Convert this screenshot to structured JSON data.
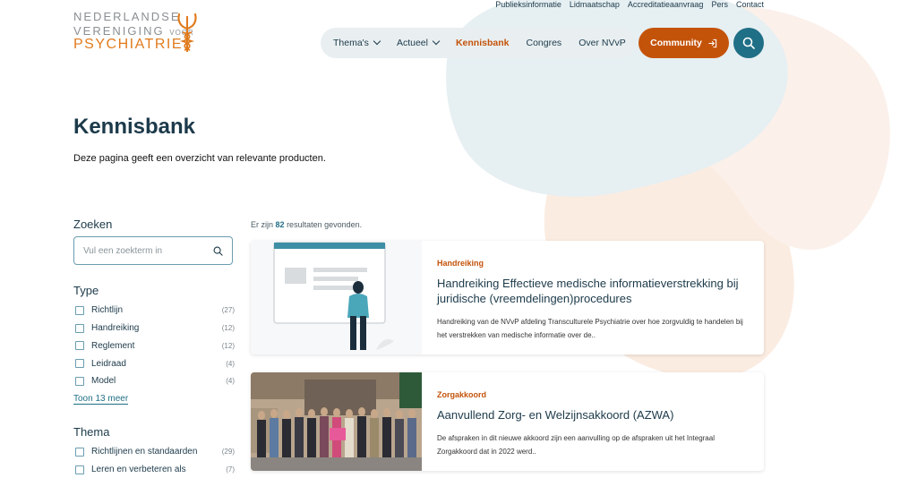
{
  "logo": {
    "line1": "NEDERLANDSE",
    "line2": "VERENIGING",
    "line2_small": "VOOR",
    "line3": "PSYCHIATRIE"
  },
  "top_links": [
    "Publieksinformatie",
    "Lidmaatschap",
    "Accreditatieaanvraag",
    "Pers",
    "Contact"
  ],
  "nav": {
    "items": [
      {
        "label": "Thema's",
        "dropdown": true
      },
      {
        "label": "Actueel",
        "dropdown": true
      },
      {
        "label": "Kennisbank",
        "dropdown": false,
        "active": true
      },
      {
        "label": "Congres",
        "dropdown": false
      },
      {
        "label": "Over NVvP",
        "dropdown": false
      }
    ],
    "community_label": "Community",
    "search_icon": "search-icon"
  },
  "page": {
    "title": "Kennisbank",
    "intro": "Deze pagina geeft een overzicht van relevante producten."
  },
  "sidebar": {
    "search_heading": "Zoeken",
    "search_placeholder": "Vul een zoekterm in",
    "type_heading": "Type",
    "type_items": [
      {
        "label": "Richtlijn",
        "count": "(27)"
      },
      {
        "label": "Handreiking",
        "count": "(12)"
      },
      {
        "label": "Reglement",
        "count": "(12)"
      },
      {
        "label": "Leidraad",
        "count": "(4)"
      },
      {
        "label": "Model",
        "count": "(4)"
      }
    ],
    "show_more": "Toon 13 meer",
    "thema_heading": "Thema",
    "thema_items": [
      {
        "label": "Richtlijnen en standaarden",
        "count": "(29)"
      },
      {
        "label": "Leren en verbeteren als",
        "count": "(7)"
      }
    ]
  },
  "results": {
    "count_prefix": "Er zijn",
    "count": "82",
    "count_suffix": "resultaten gevonden.",
    "items": [
      {
        "tag": "Handreiking",
        "title": "Handreiking Effectieve medische informatieverstrekking bij juridische (vreemdelingen)procedures",
        "description": "Handreiking van de NVvP afdeling Transculturele Psychiatrie over hoe zorgvuldig te handelen bij het verstrekken van medische informatie over de..",
        "image": "illustration-person-at-screen"
      },
      {
        "tag": "Zorgakkoord",
        "title": "Aanvullend Zorg- en Welzijnsakkoord (AZWA)",
        "description": "De afspraken in dit nieuwe akkoord zijn een aanvulling op de afspraken uit het Integraal Zorgakkoord dat in 2022 werd..",
        "image": "group-photo"
      }
    ]
  },
  "colors": {
    "brand_orange": "#c4530a",
    "logo_orange": "#e07b1d",
    "teal": "#1f6f86",
    "navy": "#1c3a4a",
    "pill_bg": "#e9eff1"
  }
}
